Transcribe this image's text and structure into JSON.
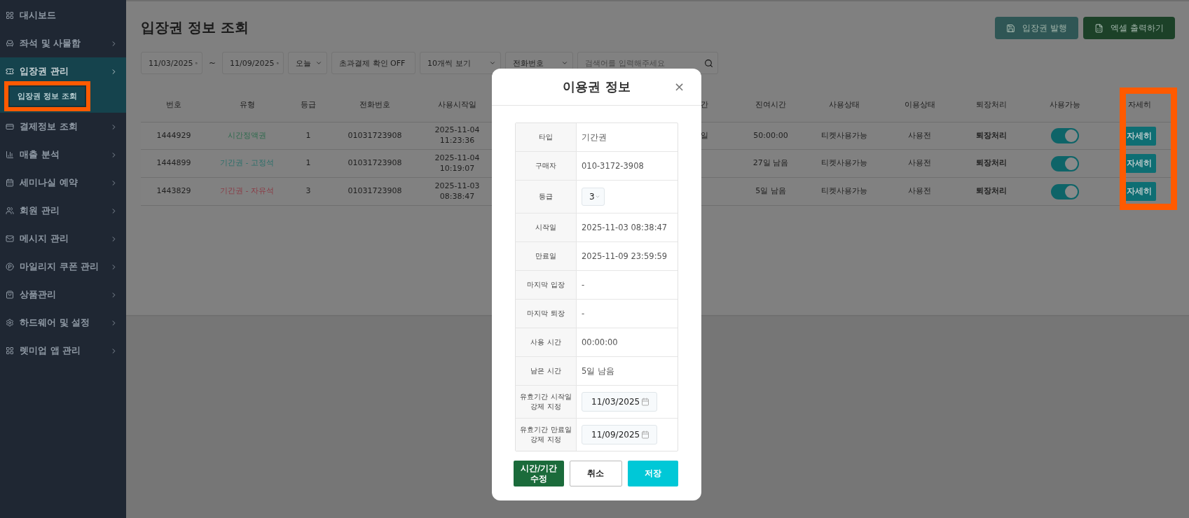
{
  "sidebar": {
    "items": [
      {
        "label": "대시보드",
        "selected": false,
        "has_arrow": false
      },
      {
        "label": "좌석 및 사물함",
        "selected": false,
        "has_arrow": true
      },
      {
        "label": "입장권 관리",
        "selected": true,
        "has_arrow": true,
        "children": [
          {
            "label": "입장권 정보 조회",
            "selected": true,
            "highlighted": true
          }
        ]
      },
      {
        "label": "결제정보 조회",
        "selected": false,
        "has_arrow": true
      },
      {
        "label": "매출 분석",
        "selected": false,
        "has_arrow": true
      },
      {
        "label": "세미나실 예약",
        "selected": false,
        "has_arrow": true
      },
      {
        "label": "회원 관리",
        "selected": false,
        "has_arrow": true
      },
      {
        "label": "메시지 관리",
        "selected": false,
        "has_arrow": true
      },
      {
        "label": "마일리지 쿠폰 관리",
        "selected": false,
        "has_arrow": true
      },
      {
        "label": "상품관리",
        "selected": false,
        "has_arrow": true
      },
      {
        "label": "하드웨어 및 설정",
        "selected": false,
        "has_arrow": true
      },
      {
        "label": "렛미업 앱 관리",
        "selected": false,
        "has_arrow": true
      }
    ]
  },
  "page": {
    "title": "입장권 정보 조회",
    "actions": [
      {
        "label": "입장권 발행",
        "kind": "issue"
      },
      {
        "label": "엑셀 출력하기",
        "kind": "excel"
      }
    ],
    "filters": {
      "start_date": "11/03/2025",
      "separator": "~",
      "end_date": "11/09/2025",
      "period": "오늘",
      "overpay_toggle": "초과결제 확인 OFF",
      "page_size": "10개씩 보기",
      "search_field": "전화번호",
      "search": {
        "placeholder": "검색어를 입력해주세요"
      }
    }
  },
  "table": {
    "columns": [
      {
        "label": "번호"
      },
      {
        "label": "유형"
      },
      {
        "label": "등급"
      },
      {
        "label": "전화번호"
      },
      {
        "label": "사용시작일"
      },
      {
        "label": "간"
      },
      {
        "label": "진여시간"
      },
      {
        "label": "사용상태"
      },
      {
        "label": "이용상태"
      },
      {
        "label": "퇴장처리"
      },
      {
        "label": "사용가능"
      },
      {
        "label": "자세히",
        "highlighted": true
      }
    ],
    "rows": [
      {
        "number": "1444929",
        "type": {
          "text": "시간정액권",
          "color": "#2f6b4e"
        },
        "grade": "1",
        "phone": "01031723908",
        "start": [
          "2025-11-04",
          "11:23:36"
        ],
        "column_6": "일",
        "remaining": "50:00:00",
        "use_status": "티켓사용가능",
        "usage": "사용전",
        "exit": "퇴장처리",
        "enabled": true,
        "detail": "자세히"
      },
      {
        "number": "1444899",
        "type": {
          "text": "기간권 - 고정석",
          "color": "#2b6f6a"
        },
        "grade": "1",
        "phone": "01031723908",
        "start": [
          "2025-11-04",
          "10:19:07"
        ],
        "remaining": "27일 남음",
        "use_status": "티켓사용가능",
        "usage": "사용전",
        "exit": "퇴장처리",
        "enabled": true,
        "detail": "자세히"
      },
      {
        "number": "1443829",
        "type": {
          "text": "기간권 - 자유석",
          "color": "#8a3b45"
        },
        "grade": "3",
        "phone": "01031723908",
        "start": [
          "2025-11-03",
          "08:38:47"
        ],
        "remaining": "5일 남음",
        "use_status": "티켓사용가능",
        "usage": "사용전",
        "exit": "퇴장처리",
        "enabled": true,
        "detail": "자세히"
      }
    ]
  },
  "modal": {
    "title": "이용권 정보",
    "close": "×",
    "rows": [
      {
        "label": "타입",
        "kind": "text",
        "value": "기간권"
      },
      {
        "label": "구매자",
        "kind": "text",
        "value": "010-3172-3908"
      },
      {
        "label": "등급",
        "kind": "select",
        "value": "3"
      },
      {
        "label": "시작일",
        "kind": "text",
        "value": "2025-11-03 08:38:47"
      },
      {
        "label": "만료일",
        "kind": "text",
        "value": "2025-11-09 23:59:59"
      },
      {
        "label": "마지막 입장",
        "kind": "text",
        "value": "-"
      },
      {
        "label": "마지막 퇴장",
        "kind": "text",
        "value": "-"
      },
      {
        "label": "사용 시간",
        "kind": "text",
        "value": "00:00:00"
      },
      {
        "label": "남은 시간",
        "kind": "text",
        "value": "5일 남음"
      },
      {
        "label": "유효기간 시작일 강제 지정",
        "kind": "date",
        "value": "11/03/2025"
      },
      {
        "label": "유효기간 만료일 강제 지정",
        "kind": "date",
        "value": "11/09/2025"
      }
    ],
    "buttons": [
      {
        "label": "시간/기간 수정",
        "kind": "edit"
      },
      {
        "label": "취소",
        "kind": "cancel"
      },
      {
        "label": "저장",
        "kind": "save"
      }
    ]
  }
}
